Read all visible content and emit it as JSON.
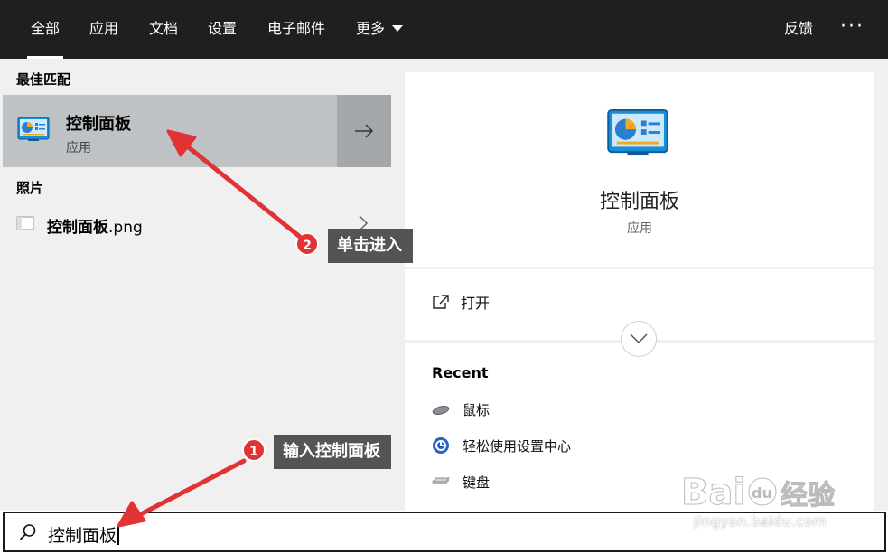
{
  "nav": {
    "tabs": [
      {
        "label": "全部",
        "active": true
      },
      {
        "label": "应用"
      },
      {
        "label": "文档"
      },
      {
        "label": "设置"
      },
      {
        "label": "电子邮件"
      },
      {
        "label": "更多"
      }
    ],
    "feedback_label": "反馈",
    "more_options": "···"
  },
  "left": {
    "best_match_heading": "最佳匹配",
    "best_match": {
      "title": "控制面板",
      "subtitle": "应用"
    },
    "photos_heading": "照片",
    "photo_item": {
      "name_bold": "控制面板",
      "name_ext": ".png"
    }
  },
  "right": {
    "app_title": "控制面板",
    "app_subtitle": "应用",
    "open_label": "打开",
    "recent_heading": "Recent",
    "recent_items": [
      "鼠标",
      "轻松使用设置中心",
      "键盘"
    ]
  },
  "search": {
    "value": "控制面板"
  },
  "annotations": {
    "step1": {
      "num": "1",
      "text": "输入控制面板"
    },
    "step2": {
      "num": "2",
      "text": "单击进入"
    }
  },
  "watermark": {
    "text": "jingyan.baidu.com"
  },
  "colors": {
    "topbar": "#1f1f1f",
    "selected_row": "#bfc2c5",
    "annotation_arrow": "#e13333"
  }
}
